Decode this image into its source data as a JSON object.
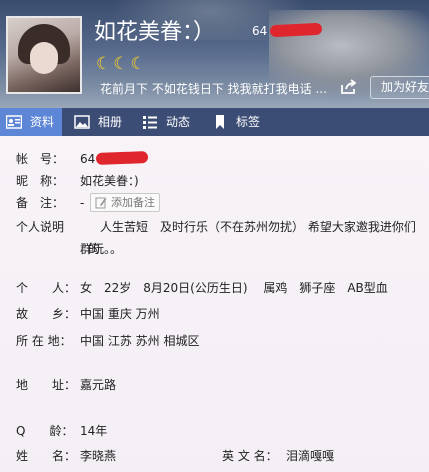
{
  "header": {
    "nickname": "如花美眷：）",
    "qq_number_prefix": "64",
    "level_icons": "☾☾☾",
    "signature": "花前月下 不如花钱日下    找我就打我电话 ...",
    "add_friend_label": "加为好友"
  },
  "tabs": [
    {
      "label": "资料",
      "icon": "profile-card-icon",
      "active": true
    },
    {
      "label": "相册",
      "icon": "photo-icon",
      "active": false
    },
    {
      "label": "动态",
      "icon": "feed-list-icon",
      "active": false
    },
    {
      "label": "标签",
      "icon": "bookmark-icon",
      "active": false
    }
  ],
  "profile": {
    "account_label": "帐　号：",
    "account_value": "64",
    "nickname_label": "昵　称：",
    "nickname_value": "如花美眷：)",
    "note_label": "备　注：",
    "note_value": "-",
    "add_note_label": "添加备注",
    "about_label": "个人说明",
    "about_value": "　人生苦短　及时行乐（不在苏州勿扰）  希望大家邀我进你们的",
    "about_value_2": "群玩。。",
    "personal_label": "个　　人：",
    "personal_value": "女　22岁　8月20日(公历生日)　 属鸡　狮子座　AB型血",
    "hometown_label": "故　　乡：",
    "hometown_value": "中国 重庆 万州",
    "location_label": "所 在 地：",
    "location_value": "中国 江苏 苏州 相城区",
    "address_label": "地　　址：",
    "address_value": "嘉元路",
    "qage_label": "Q　　龄：",
    "qage_value": "14年",
    "name_label": "姓　　名：",
    "name_value": "李晓燕",
    "english_name_label": "英 文 名：",
    "english_name_value": "泪滴嘎嘎"
  }
}
